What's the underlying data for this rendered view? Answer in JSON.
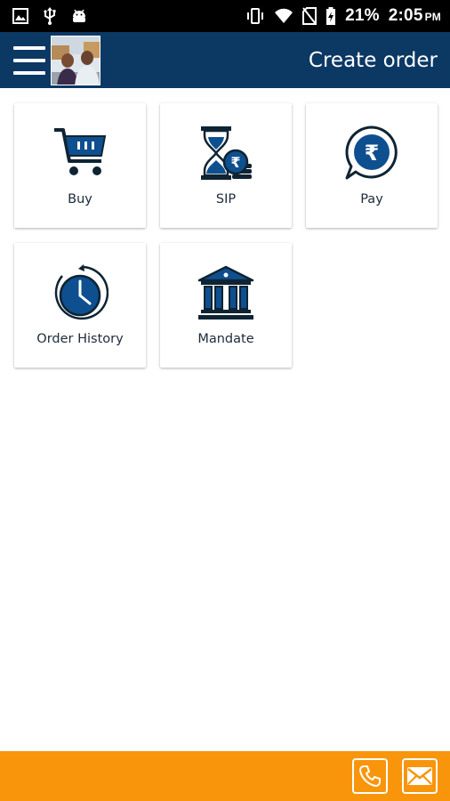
{
  "status_bar": {
    "battery_percent": "21%",
    "time": "2:05",
    "ampm": "PM",
    "icons": [
      "gallery-icon",
      "usb-icon",
      "android-icon",
      "vibrate-icon",
      "wifi-icon",
      "no-sim-icon",
      "battery-charging-icon"
    ]
  },
  "app_bar": {
    "title": "Create order",
    "menu_icon": "hamburger-menu-icon"
  },
  "tiles": [
    {
      "label": "Buy",
      "icon": "shopping-cart-icon"
    },
    {
      "label": "SIP",
      "icon": "hourglass-rupee-icon"
    },
    {
      "label": "Pay",
      "icon": "rupee-chat-icon"
    },
    {
      "label": "Order History",
      "icon": "clock-history-icon"
    },
    {
      "label": "Mandate",
      "icon": "bank-icon"
    }
  ],
  "bottom_bar": {
    "icons": [
      "phone-icon",
      "mail-icon"
    ]
  },
  "colors": {
    "app_bar": "#0c3864",
    "accent_blue": "#0e4f8f",
    "icon_dark": "#0f2433",
    "bottom_bar": "#f8950b",
    "status_bar": "#000000"
  }
}
